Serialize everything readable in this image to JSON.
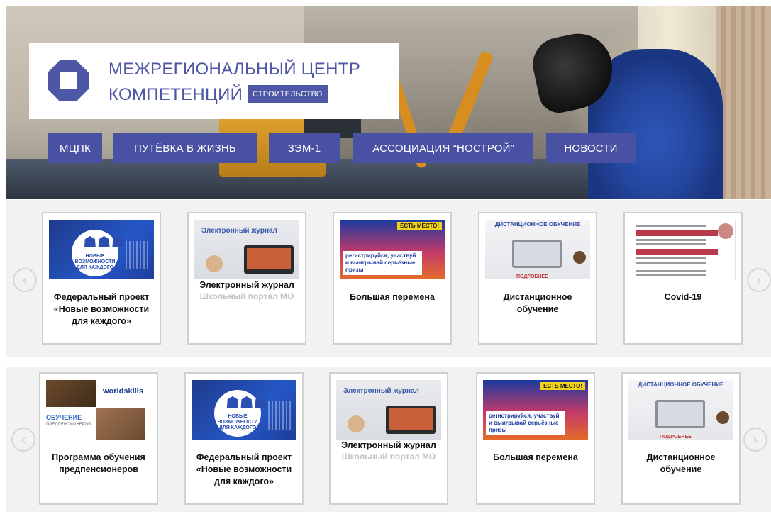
{
  "header": {
    "logo_line1": "МЕЖРЕГИОНАЛЬНЫЙ ЦЕНТР",
    "logo_line2": "КОМПЕТЕНЦИЙ",
    "logo_tag": "СТРОИТЕЛЬСТВО"
  },
  "nav": [
    {
      "label": "МЦПК"
    },
    {
      "label": "ПУТЁВКА В ЖИЗНЬ"
    },
    {
      "label": "ЗЭМ-1"
    },
    {
      "label": "АССОЦИАЦИЯ “НОСТРОЙ”"
    },
    {
      "label": "НОВОСТИ"
    }
  ],
  "carousel1": {
    "cards": [
      {
        "title": "Федеральный проект «Новые возможности для каждого»"
      },
      {
        "title": "Электронный журнал",
        "subtitle": "Школьный портал МО"
      },
      {
        "title": "Большая перемена"
      },
      {
        "title": "Дистанционное обучение"
      },
      {
        "title": "Covid-19"
      }
    ]
  },
  "carousel2": {
    "cards": [
      {
        "title": "Программа обучения предпенсионеров"
      },
      {
        "title": "Федеральный проект «Новые возможности для каждого»"
      },
      {
        "title": "Электронный журнал",
        "subtitle": "Школьный портал МО"
      },
      {
        "title": "Большая перемена"
      },
      {
        "title": "Дистанционное обучение"
      }
    ]
  },
  "thumbs": {
    "fed_caption": "НОВЫЕ ВОЗМОЖНОСТИ ДЛЯ КАЖДОГО",
    "ej_caption": "Электронный журнал",
    "bp_tag": "ЕСТЬ МЕСТО!",
    "bp_ribbon": "регистрируйся, участвуй и выигрывай серьёзные призы",
    "do_caption": "ДИСТАНЦИОННОЕ ОБУЧЕНИЕ",
    "do_more": "ПОДРОБНЕЕ",
    "wsk_brand": "worldskills",
    "wsk_title": "ОБУЧЕНИЕ",
    "wsk_sub": "ПРЕДПЕНСИОНЕРОВ"
  },
  "icons": {
    "prev": "chevron-left-icon",
    "next": "chevron-right-icon"
  },
  "colors": {
    "brand": "#4e56a6",
    "nav_bg": "#4951a3",
    "strip_bg": "#f2f2f2"
  }
}
